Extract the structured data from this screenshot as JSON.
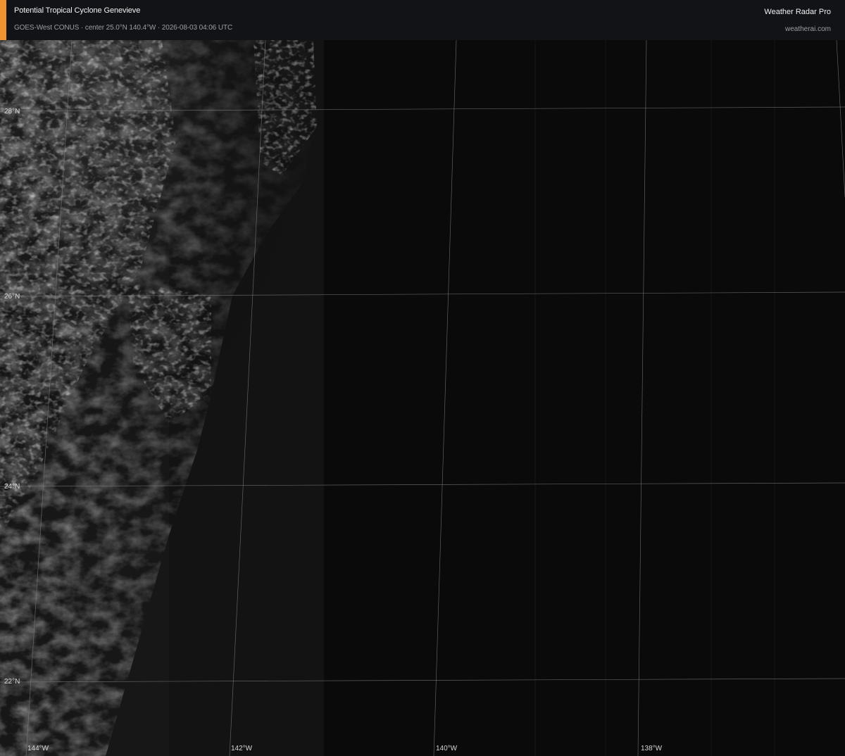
{
  "header": {
    "title": "Potential Tropical Cyclone Genevieve",
    "subtitle": "GOES-West CONUS · center 25.0°N 140.4°W · 2026-08-03 04:06 UTC",
    "brand": "Weather Radar Pro",
    "url": "weatherai.com",
    "accent_color": "#f0922f"
  },
  "map": {
    "type": "satellite-visible",
    "latitude_labels": [
      "28°N",
      "26°N",
      "24°N",
      "22°N"
    ],
    "longitude_labels": [
      "144°W",
      "142°W",
      "140°W",
      "138°W"
    ],
    "gridline_color": "#7c7c7c"
  }
}
